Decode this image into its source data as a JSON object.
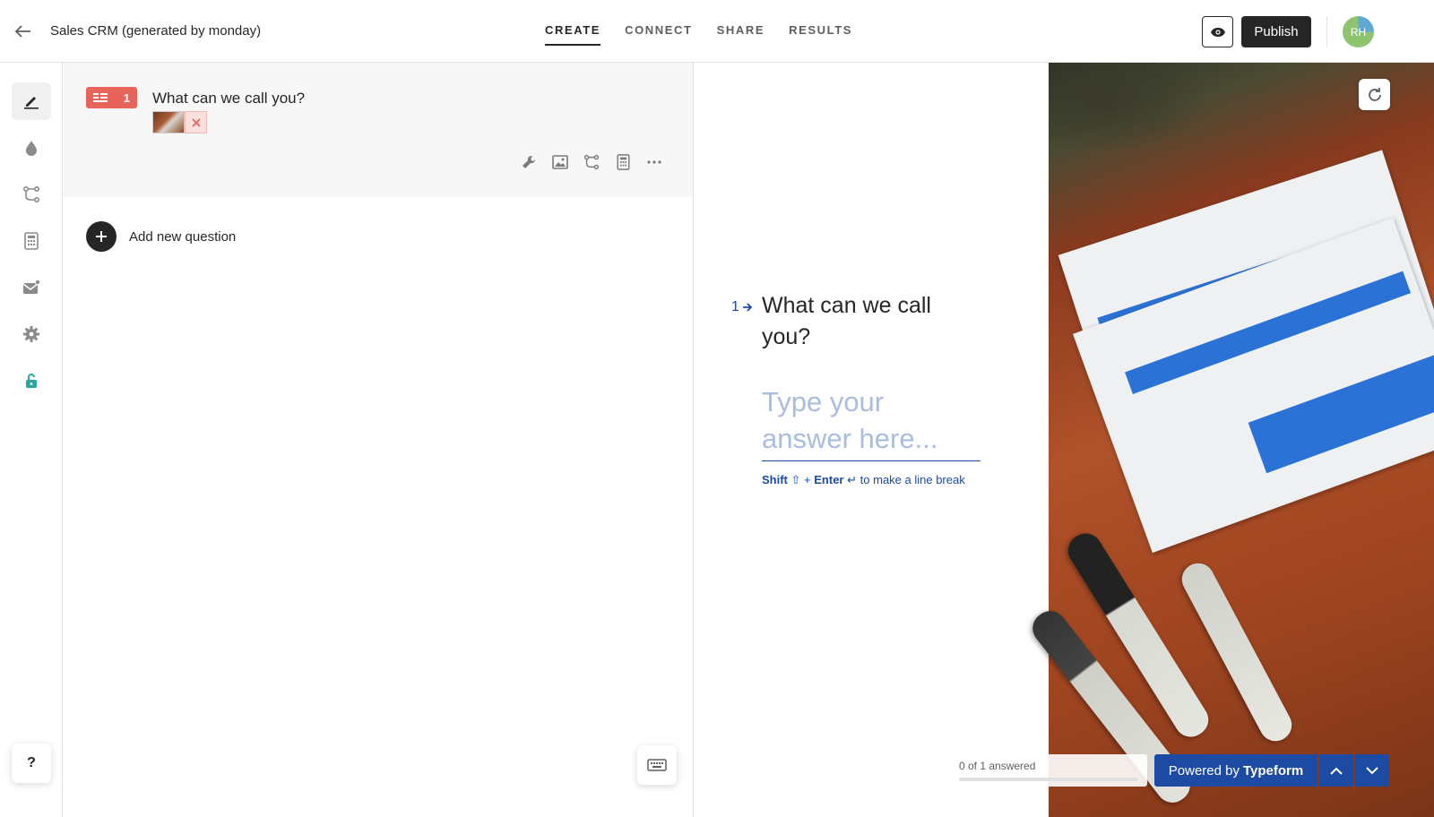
{
  "header": {
    "form_title": "Sales CRM (generated by monday)",
    "tabs": [
      {
        "label": "CREATE",
        "active": true
      },
      {
        "label": "CONNECT",
        "active": false
      },
      {
        "label": "SHARE",
        "active": false
      },
      {
        "label": "RESULTS",
        "active": false
      }
    ],
    "publish_label": "Publish",
    "avatar_initials": "RH"
  },
  "rail": {
    "items": [
      "pencil-icon",
      "drop-icon",
      "logic-icon",
      "calculator-icon",
      "mail-icon",
      "gear-icon",
      "lock-icon"
    ],
    "help_label": "?"
  },
  "editor": {
    "question": {
      "number": "1",
      "title": "What can we call you?"
    },
    "tools": [
      "wrench-icon",
      "image-icon",
      "logic-icon",
      "calculator-icon",
      "more-icon"
    ],
    "add_question_label": "Add new question"
  },
  "preview": {
    "question_number": "1",
    "question_text": "What can we call you?",
    "answer_placeholder": "Type your answer here...",
    "hint": {
      "shift": "Shift",
      "plus": "+",
      "enter": "Enter",
      "rest": "to make a line break"
    },
    "progress_label": "0 of 1 answered",
    "progress_fraction": 0,
    "powered_prefix": "Powered by",
    "powered_brand": "Typeform"
  },
  "colors": {
    "accent": "#1d4ba4",
    "badge": "#e8645a",
    "dark": "#262627"
  }
}
